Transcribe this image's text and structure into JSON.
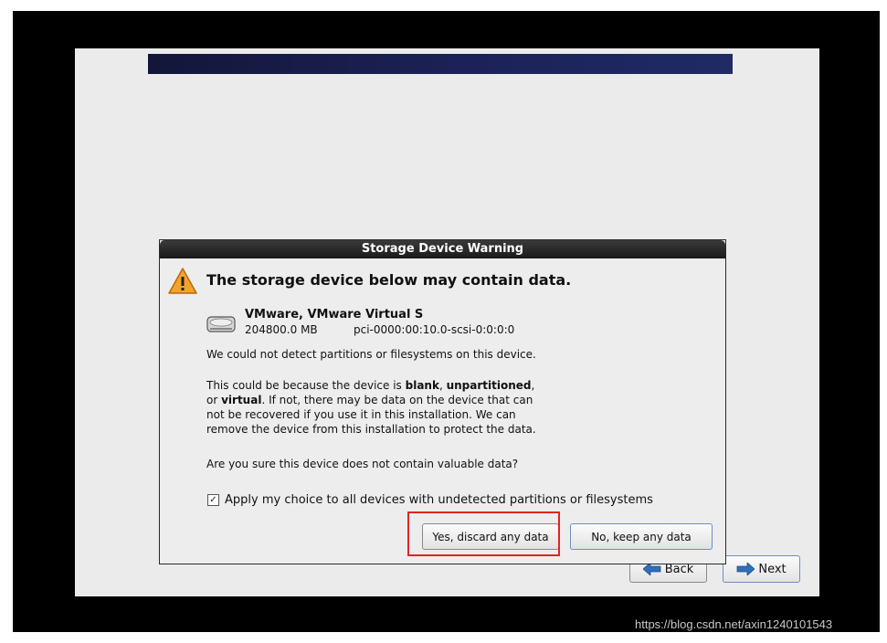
{
  "dialog": {
    "title": "Storage Device Warning",
    "heading": "The storage device below may contain data.",
    "device": {
      "name": "VMware, VMware Virtual S",
      "size": "204800.0 MB",
      "path": "pci-0000:00:10.0-scsi-0:0:0:0"
    },
    "paragraph1": "We could not detect partitions or filesystems on this device.",
    "paragraph2": {
      "part1": "This could be because the device is ",
      "blank": "blank",
      "sep1": ", ",
      "unpartitioned": "unpartitioned",
      "sep2": ",",
      "line2_prefix": "or ",
      "virtual": "virtual",
      "line2_rest": ". If not, there may be data on the device that can",
      "line3": "not be recovered if you use it in this installation. We can",
      "line4": "remove the device from this installation to protect the data."
    },
    "paragraph3": "Are you sure this device does not contain valuable data?",
    "apply_choice": {
      "label": "Apply my choice to all devices with undetected partitions or filesystems",
      "checked": true,
      "mark": "✓"
    },
    "yes_button": "Yes, discard any data",
    "no_button": "No, keep any data"
  },
  "navigation": {
    "back_label": "Back",
    "next_label": "Next"
  },
  "watermark": "https://blog.csdn.net/axin1240101543",
  "colors": {
    "highlight": "#e32222",
    "banner": "#1c2258",
    "warning": "#f0a020"
  },
  "icons": {
    "warning": "warning-triangle-icon",
    "disk": "hard-disk-icon",
    "back": "back-arrow-icon",
    "next": "next-arrow-icon"
  }
}
